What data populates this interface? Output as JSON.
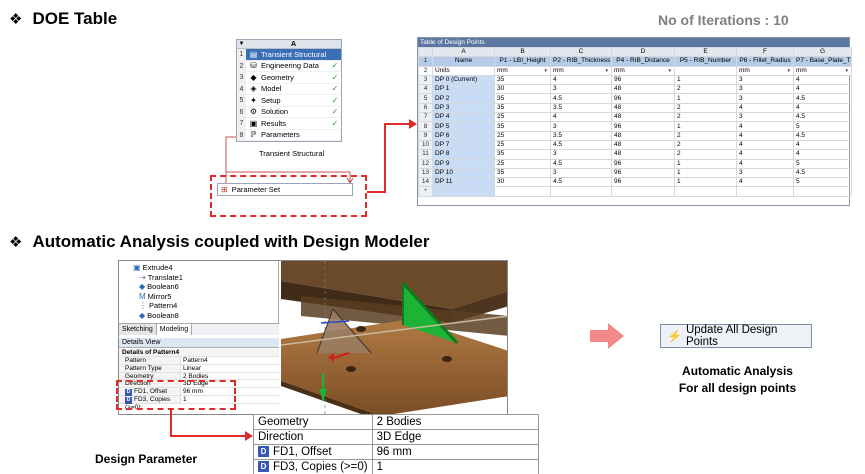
{
  "headings": {
    "doe": "DOE Table",
    "auto": "Automatic Analysis coupled with Design Modeler"
  },
  "iterations_label": "No of Iterations : 10",
  "workbench": {
    "column_letter": "A",
    "rows": [
      {
        "num": "1",
        "label": "Transient Structural",
        "icon": "transient-structural-icon",
        "check": ""
      },
      {
        "num": "2",
        "label": "Engineering Data",
        "icon": "engineering-data-icon",
        "check": "✓"
      },
      {
        "num": "3",
        "label": "Geometry",
        "icon": "geometry-icon",
        "check": "✓"
      },
      {
        "num": "4",
        "label": "Model",
        "icon": "model-icon",
        "check": "✓"
      },
      {
        "num": "5",
        "label": "Setup",
        "icon": "setup-icon",
        "check": "✓"
      },
      {
        "num": "6",
        "label": "Solution",
        "icon": "solution-icon",
        "check": "✓"
      },
      {
        "num": "7",
        "label": "Results",
        "icon": "results-icon",
        "check": "✓"
      },
      {
        "num": "8",
        "label": "Parameters",
        "icon": "parameters-icon",
        "check": ""
      }
    ],
    "caption": "Transient Structural",
    "parameter_set": "Parameter Set"
  },
  "design_points": {
    "title": "Table of Design Points",
    "letters": [
      "A",
      "B",
      "C",
      "D",
      "E",
      "F",
      "G"
    ],
    "headers": [
      "Name",
      "P1 - LBI_Height",
      "P2 - RIB_Thickness",
      "P4 - RIB_Distance",
      "P5 - RIB_Number",
      "P6 - Fillet_Radius",
      "P7 - Base_Plate_THK"
    ],
    "units": [
      "Units",
      "mm",
      "mm",
      "mm",
      "",
      "mm",
      "mm"
    ],
    "rows": [
      [
        "DP 0 (Current)",
        "35",
        "4",
        "96",
        "1",
        "3",
        "4"
      ],
      [
        "DP 1",
        "30",
        "3",
        "48",
        "2",
        "3",
        "4"
      ],
      [
        "DP 2",
        "35",
        "4.5",
        "96",
        "1",
        "3",
        "4.5"
      ],
      [
        "DP 3",
        "35",
        "3.5",
        "48",
        "2",
        "4",
        "4"
      ],
      [
        "DP 4",
        "25",
        "4",
        "48",
        "2",
        "3",
        "4.5"
      ],
      [
        "DP 5",
        "35",
        "3",
        "96",
        "1",
        "4",
        "5"
      ],
      [
        "DP 6",
        "25",
        "3.5",
        "48",
        "2",
        "4",
        "4.5"
      ],
      [
        "DP 7",
        "25",
        "4.5",
        "48",
        "2",
        "4",
        "4"
      ],
      [
        "DP 8",
        "35",
        "3",
        "48",
        "2",
        "4",
        "4"
      ],
      [
        "DP 9",
        "25",
        "4.5",
        "96",
        "1",
        "4",
        "5"
      ],
      [
        "DP 10",
        "35",
        "3",
        "96",
        "1",
        "3",
        "4.5"
      ],
      [
        "DP 11",
        "30",
        "4.5",
        "96",
        "1",
        "4",
        "5"
      ]
    ],
    "row_numbers": [
      "1",
      "2",
      "3",
      "4",
      "5",
      "6",
      "7",
      "8",
      "9",
      "10",
      "11",
      "12",
      "13",
      "14",
      "*"
    ]
  },
  "design_modeler": {
    "tree": [
      "Extrude4",
      "Translate1",
      "Boolean6",
      "Mirror5",
      "Pattern4",
      "Boolean8"
    ],
    "tabs": [
      "Sketching",
      "Modeling"
    ],
    "details_view": "Details View",
    "details_heading": "Details of Pattern4",
    "details": [
      {
        "k": "Pattern",
        "v": "Pattern4",
        "badge": ""
      },
      {
        "k": "Pattern Type",
        "v": "Linear",
        "badge": ""
      },
      {
        "k": "Geometry",
        "v": "2 Bodies",
        "badge": ""
      },
      {
        "k": "Direction",
        "v": "3D Edge",
        "badge": ""
      },
      {
        "k": "FD1, Offset",
        "v": "96 mm",
        "badge": "D"
      },
      {
        "k": "FD3, Copies (>=0)",
        "v": "1",
        "badge": "D"
      }
    ]
  },
  "enlarged_params": [
    {
      "k": "Geometry",
      "v": "2 Bodies",
      "badge": ""
    },
    {
      "k": "Direction",
      "v": "3D Edge",
      "badge": ""
    },
    {
      "k": "FD1, Offset",
      "v": "96 mm",
      "badge": "D"
    },
    {
      "k": "FD3, Copies (>=0)",
      "v": "1",
      "badge": "D"
    }
  ],
  "design_parameter_label": "Design Parameter",
  "update_button": "Update All Design Points",
  "auto_text": [
    "Automatic Analysis",
    "For all design points"
  ],
  "colors": {
    "accent_red": "#e12b2b",
    "arrow_pink": "#f4888a",
    "selected_blue": "#3a6fb5"
  }
}
